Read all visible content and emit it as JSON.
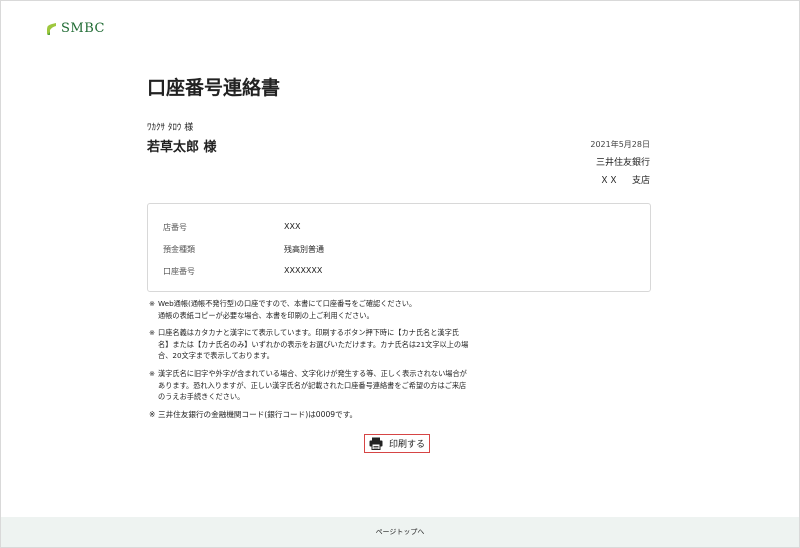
{
  "header": {
    "logo_text": "SMBC",
    "brand_color": "#1f6b33"
  },
  "document": {
    "title": "口座番号連絡書",
    "kana_name": "ﾜｶｸｻ ﾀﾛｳ 様",
    "name": "若草太郎 様",
    "date": "2021年5月28日",
    "bank_name": "三井住友銀行",
    "branch_code": "ＸＸ",
    "branch_suffix": "支店"
  },
  "info": {
    "rows": [
      {
        "label": "店番号",
        "value": "XXX"
      },
      {
        "label": "預金種類",
        "value": "残高別普通"
      },
      {
        "label": "口座番号",
        "value": "XXXXXXX"
      }
    ]
  },
  "notes": {
    "mark": "※",
    "n1_l1": "Web通帳(通帳不発行型)の口座ですので、本書にて口座番号をご確認ください。",
    "n1_l2": "通帳の表紙コピーが必要な場合、本書を印刷の上ご利用ください。",
    "n2_l1": "口座名義はカタカナと漢字にて表示しています。印刷するボタン押下時に【カナ氏名と漢字氏",
    "n2_l2": "名】または【カナ氏名のみ】いずれかの表示をお選びいただけます。カナ氏名は21文字以上の場",
    "n2_l3": "合、20文字まで表示しております。",
    "n3_l1": "漢字氏名に旧字や外字が含まれている場合、文字化けが発生する等、正しく表示されない場合が",
    "n3_l2": "あります。恐れ入りますが、正しい漢字氏名が記載された口座番号連絡書をご希望の方はご来店",
    "n3_l3": "のうえお手続きください。",
    "n4_l1": "三井住友銀行の金融機関コード(銀行コード)は0009です。"
  },
  "print_button": {
    "label": "印刷する",
    "icon": "printer-icon",
    "border_color": "#d64545"
  },
  "footer": {
    "page_top_label": "ページトップへ",
    "background": "#eef3f1"
  }
}
